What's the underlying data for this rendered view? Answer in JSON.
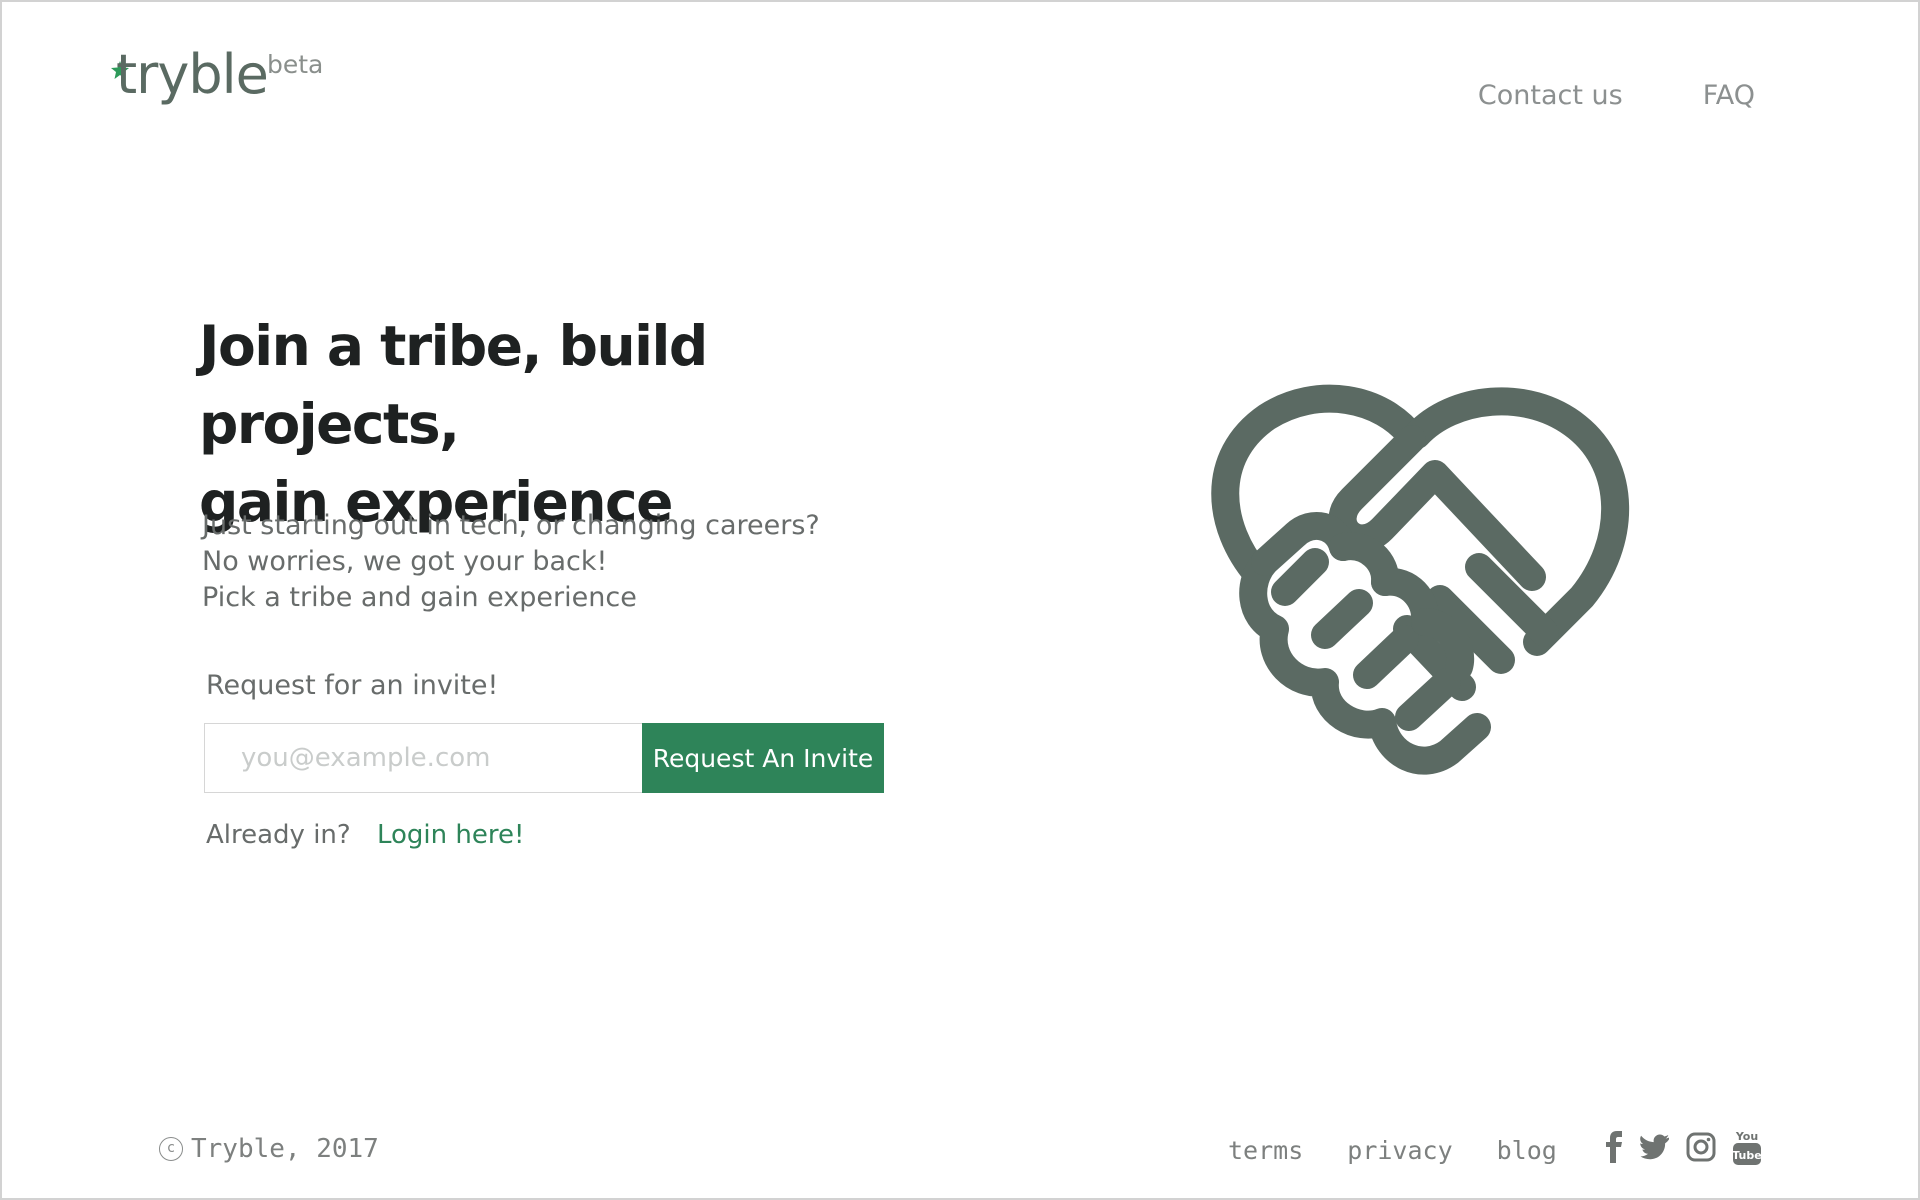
{
  "header": {
    "logo_text": "tryble",
    "logo_badge": "beta",
    "nav": [
      {
        "label": "Contact us"
      },
      {
        "label": "FAQ"
      }
    ]
  },
  "hero": {
    "headline_line1": "Join a tribe, build projects,",
    "headline_line2": "gain experience",
    "tagline_lines": [
      "Just starting out in tech, or changing careers?",
      "No worries, we got your back!",
      "Pick a tribe and gain experience"
    ],
    "invite_label": "Request for an invite!",
    "email_placeholder": "you@example.com",
    "email_value": "",
    "invite_button": "Request An Invite",
    "login_prompt": "Already in?",
    "login_link": "Login here!",
    "illustration_icon": "heart-handshake-icon"
  },
  "footer": {
    "copyright": "Tryble, 2017",
    "links": [
      {
        "label": "terms"
      },
      {
        "label": "privacy"
      },
      {
        "label": "blog"
      }
    ],
    "social": [
      {
        "icon": "facebook-icon"
      },
      {
        "icon": "twitter-icon"
      },
      {
        "icon": "instagram-icon"
      },
      {
        "icon": "youtube-icon"
      }
    ]
  },
  "colors": {
    "brand_green": "#2e8459",
    "icon_gray": "#5a6a62",
    "headline": "#1e2121",
    "body_text": "#686c6b",
    "muted": "#8c9090"
  }
}
